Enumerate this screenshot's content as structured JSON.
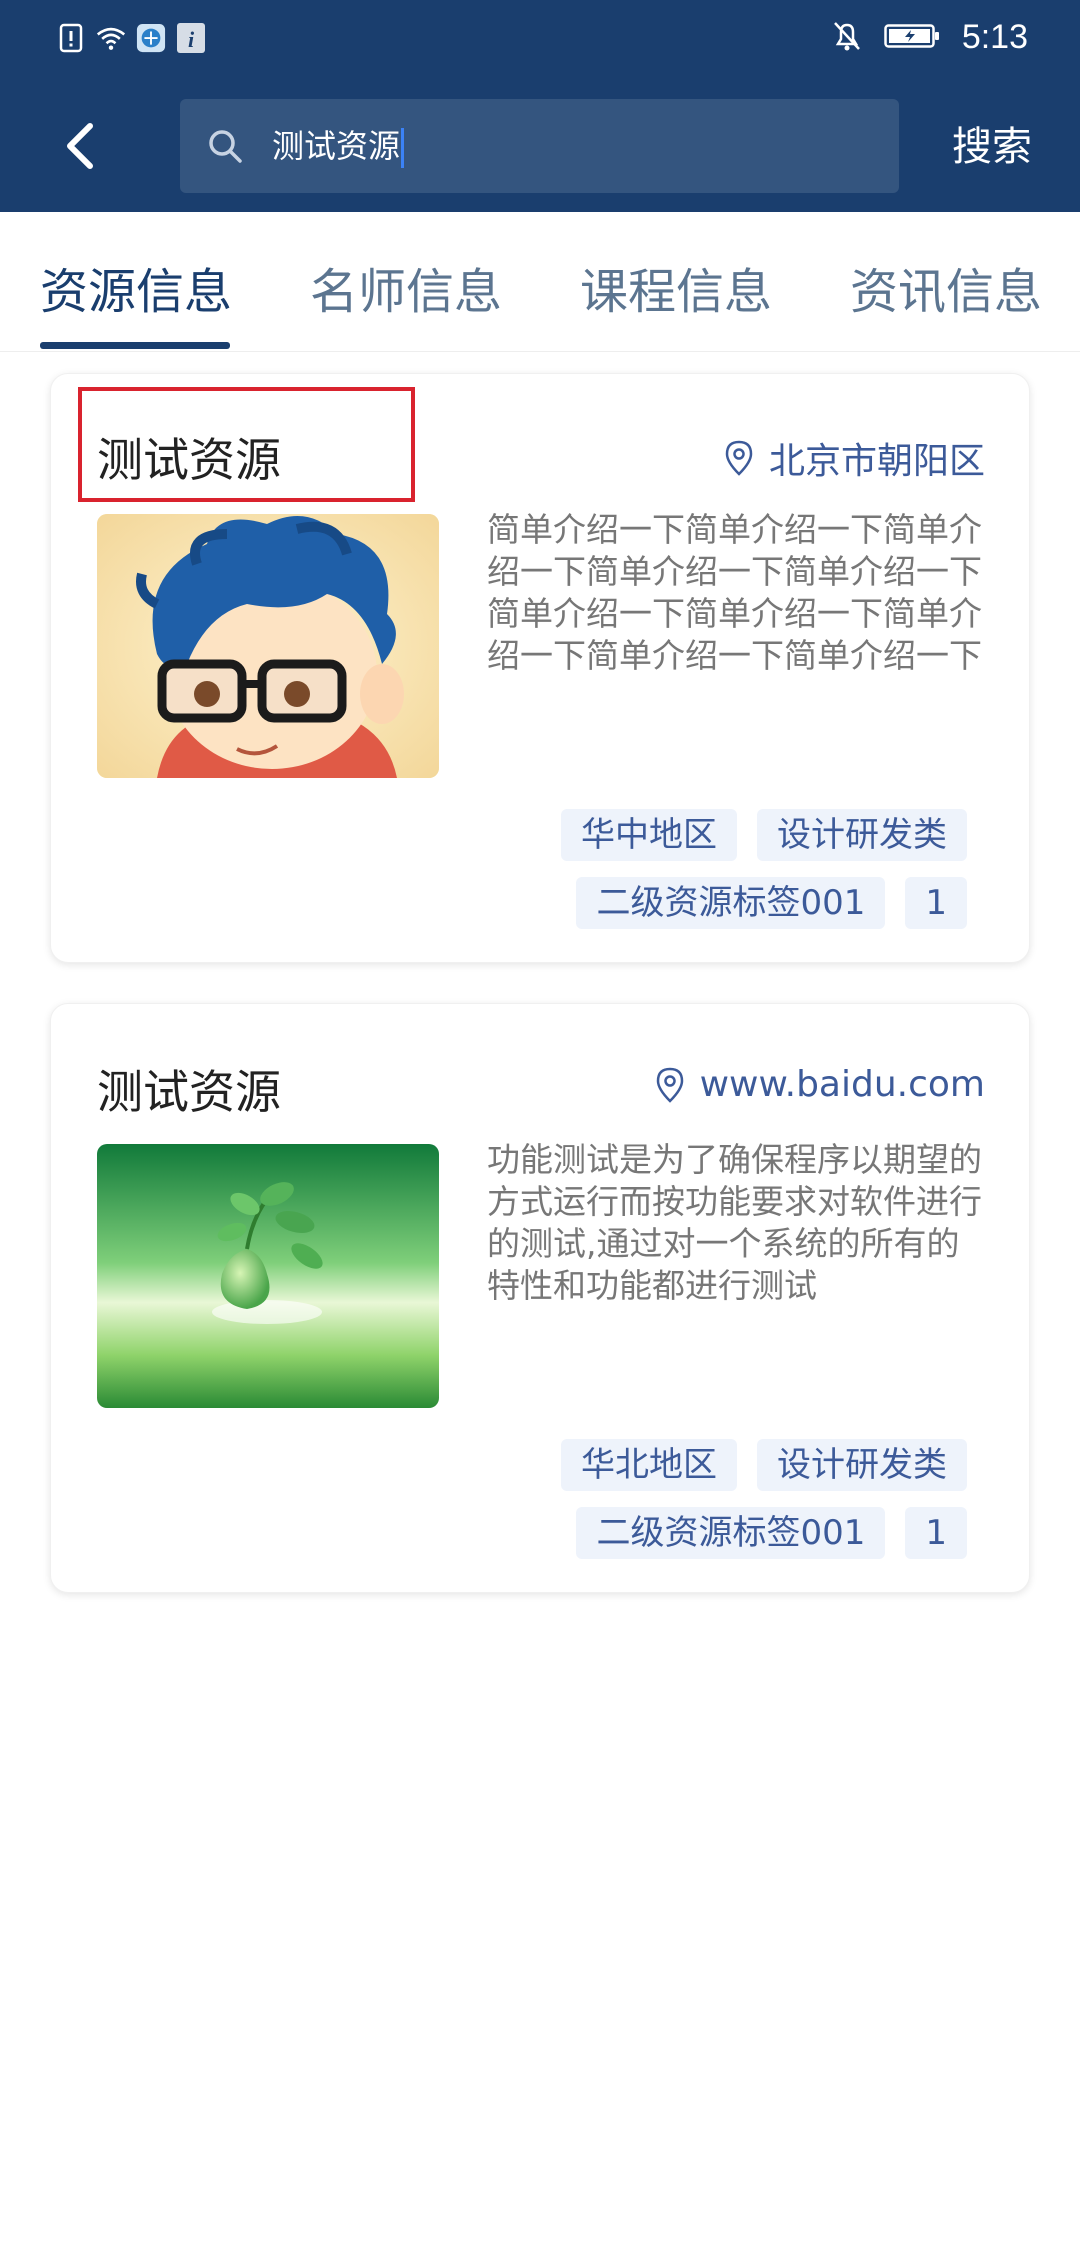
{
  "status_bar": {
    "time": "5:13",
    "icons_left": [
      "sim-alert-icon",
      "wifi-icon",
      "app-badge-icon",
      "info-icon"
    ],
    "icons_right": [
      "bell-off-icon",
      "battery-charging-icon"
    ]
  },
  "app_bar": {
    "back_icon": "chevron-left-icon",
    "search_value": "测试资源",
    "search_button_label": "搜索"
  },
  "tabs": [
    {
      "label": "资源信息",
      "active": true
    },
    {
      "label": "名师信息",
      "active": false
    },
    {
      "label": "课程信息",
      "active": false
    },
    {
      "label": "资讯信息",
      "active": false
    }
  ],
  "cards": [
    {
      "title": "测试资源",
      "location": "北京市朝阳区",
      "description": "简单介绍一下简单介绍一下简单介绍一下简单介绍一下简单介绍一下简单介绍一下简单介绍一下简单介绍一下简单介绍一下简单介绍一下",
      "image": "cartoon-avatar-image",
      "tags": [
        "华中地区",
        "设计研发类",
        "二级资源标签001",
        "1"
      ]
    },
    {
      "title": "测试资源",
      "location": "www.baidu.com",
      "description": "功能测试是为了确保程序以期望的方式运行而按功能要求对软件进行的测试,通过对一个系统的所有的特性和功能都进行测试",
      "image": "green-sprout-image",
      "tags": [
        "华北地区",
        "设计研发类",
        "二级资源标签001",
        "1"
      ]
    }
  ],
  "colors": {
    "primary": "#1a3e6e",
    "search_bg": "#34557f",
    "accent_text": "#3c5a99",
    "tag_bg": "#eef3fb",
    "highlight": "#d9232e"
  }
}
